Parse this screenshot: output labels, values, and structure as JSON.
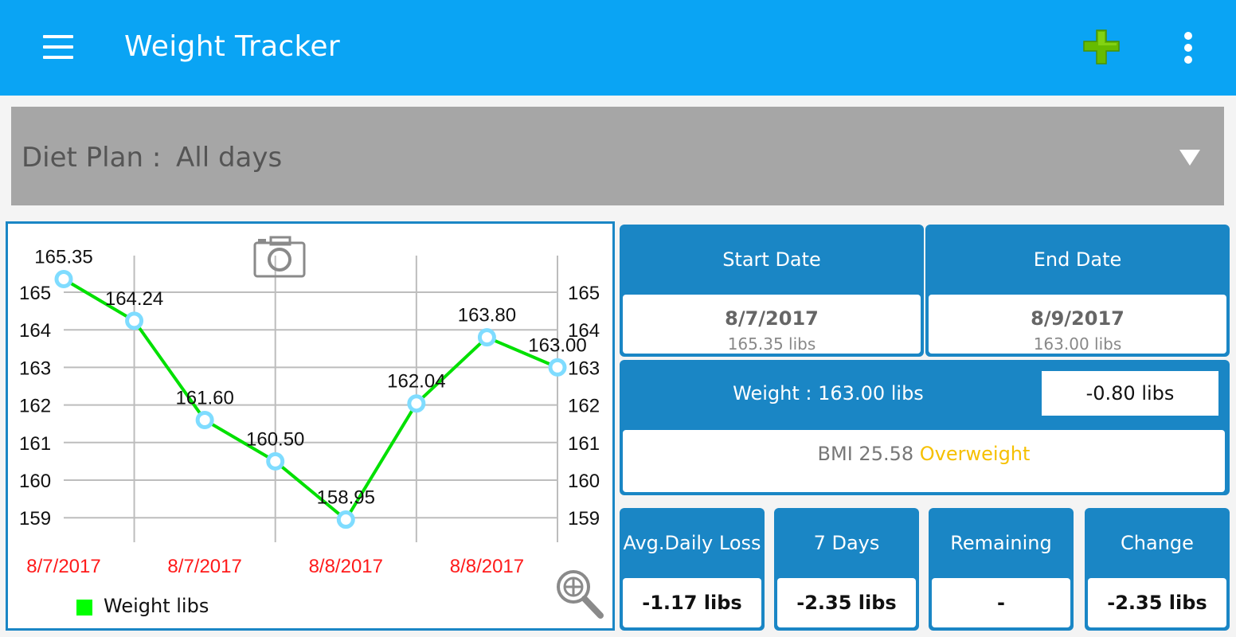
{
  "app": {
    "title": "Weight Tracker",
    "icons": {
      "menu": "hamburger-menu-icon",
      "add": "green-plus-icon",
      "more": "vertical-dots-icon"
    },
    "colors": {
      "appbar": "#0aa4f4",
      "card": "#1a86c5",
      "add": "#66bb00",
      "line": "#00e000",
      "marker": "#7fdcff",
      "date_label": "#ff1a1a",
      "overweight": "#f6c000"
    }
  },
  "diet_plan": {
    "label": "Diet Plan :",
    "value": "All days"
  },
  "chart": {
    "legend": "Weight libs",
    "icons": {
      "camera": "camera-icon",
      "zoom": "zoom-magnifier-icon"
    }
  },
  "chart_data": {
    "type": "line",
    "x_labels": [
      "8/7/2017",
      "8/7/2017",
      "8/8/2017",
      "8/8/2017"
    ],
    "series": [
      {
        "name": "Weight libs",
        "values": [
          165.35,
          164.24,
          161.6,
          160.5,
          158.95,
          162.04,
          163.8,
          163.0
        ],
        "labels": [
          "165.35",
          "164.24",
          "161.60",
          "160.50",
          "158.95",
          "162.04",
          "163.80",
          "163.00"
        ]
      }
    ],
    "y_ticks": [
      159,
      160,
      161,
      162,
      163,
      164,
      165
    ],
    "ylim": [
      158.5,
      166
    ],
    "grid": true,
    "legend_position": "bottom-left"
  },
  "dates": {
    "start": {
      "label": "Start Date",
      "value": "8/7/2017",
      "sub": "165.35 libs"
    },
    "end": {
      "label": "End Date",
      "value": "8/9/2017",
      "sub": "163.00 libs"
    }
  },
  "weight": {
    "text": "Weight : 163.00 libs",
    "diff": "-0.80 libs",
    "bmi": "BMI 25.58",
    "bmi_category": "Overweight"
  },
  "stats": [
    {
      "label": "Avg.Daily Loss",
      "value": "-1.17 libs"
    },
    {
      "label": "7 Days",
      "value": "-2.35 libs"
    },
    {
      "label": "Remaining",
      "value": "-"
    },
    {
      "label": "Change",
      "value": "-2.35 libs"
    }
  ]
}
